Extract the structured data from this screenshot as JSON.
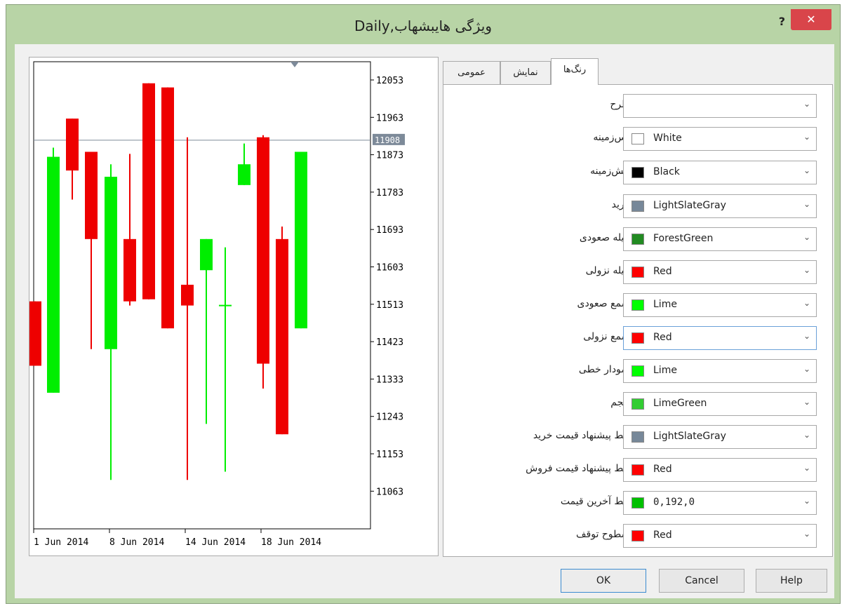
{
  "window": {
    "title": "Daily,ویژگی هایبشهاب",
    "help_label": "?",
    "close_label": "✕"
  },
  "tabs": [
    {
      "label": "رنگ‌ها",
      "active": true
    },
    {
      "label": "نمایش",
      "active": false
    },
    {
      "label": "عمومی",
      "active": false
    }
  ],
  "properties": [
    {
      "label": ":طرح",
      "value": "",
      "swatch": null
    },
    {
      "label": ":پس‌زمینه",
      "value": "White",
      "swatch": "#ffffff"
    },
    {
      "label": ":پیش‌زمینه",
      "value": "Black",
      "swatch": "#000000"
    },
    {
      "label": ":گرید",
      "value": "LightSlateGray",
      "swatch": "#778899"
    },
    {
      "label": ":میله صعودی",
      "value": "ForestGreen",
      "swatch": "#228b22"
    },
    {
      "label": ":میله نزولی",
      "value": "Red",
      "swatch": "#ff0000"
    },
    {
      "label": ":شمع صعودی",
      "value": "Lime",
      "swatch": "#00ff00"
    },
    {
      "label": ":شمع نزولی",
      "value": "Red",
      "swatch": "#ff0000"
    },
    {
      "label": ":نمودار خطی",
      "value": "Lime",
      "swatch": "#00ff00"
    },
    {
      "label": ":حجم",
      "value": "LimeGreen",
      "swatch": "#32cd32"
    },
    {
      "label": ":خط پیشنهاد قیمت خرید",
      "value": "LightSlateGray",
      "swatch": "#778899"
    },
    {
      "label": ":خط پیشنهاد قیمت فروش",
      "value": "Red",
      "swatch": "#ff0000"
    },
    {
      "label": ":خط آخرین قیمت",
      "value": "0,192,0",
      "swatch": "#00c000"
    },
    {
      "label": ":سطوح توقف",
      "value": "Red",
      "swatch": "#ff0000"
    }
  ],
  "buttons": {
    "ok": "OK",
    "cancel": "Cancel",
    "help": "Help"
  },
  "chart_data": {
    "type": "candlestick",
    "price_labels": [
      "12053",
      "11963",
      "11873",
      "11783",
      "11693",
      "11603",
      "11513",
      "11423",
      "11333",
      "11243",
      "11153",
      "11063"
    ],
    "current_price": "11908",
    "date_labels": [
      "1 Jun 2014",
      "8 Jun 2014",
      "14 Jun 2014",
      "18 Jun 2014"
    ],
    "ylim": [
      11000,
      12110
    ],
    "bull_color": "#00ee00",
    "bear_color": "#ee0000",
    "candles": [
      {
        "open": 11520,
        "close": 11365,
        "high": 11520,
        "low": 11365
      },
      {
        "open": 11300,
        "close": 11868,
        "high": 11890,
        "low": 11300
      },
      {
        "open": 11960,
        "close": 11835,
        "high": 11960,
        "low": 11765
      },
      {
        "open": 11880,
        "close": 11670,
        "high": 11880,
        "low": 11405
      },
      {
        "open": 11405,
        "close": 11820,
        "high": 11850,
        "low": 11090
      },
      {
        "open": 11670,
        "close": 11520,
        "high": 11875,
        "low": 11510
      },
      {
        "open": 12045,
        "close": 11525,
        "high": 12045,
        "low": 11525
      },
      {
        "open": 12035,
        "close": 11455,
        "high": 12035,
        "low": 11455
      },
      {
        "open": 11560,
        "close": 11510,
        "high": 11915,
        "low": 11090
      },
      {
        "open": 11595,
        "close": 11670,
        "high": 11670,
        "low": 11225
      },
      {
        "open": 11510,
        "close": 11510,
        "high": 11650,
        "low": 11110
      },
      {
        "open": 11800,
        "close": 11850,
        "high": 11900,
        "low": 11800
      },
      {
        "open": 11915,
        "close": 11370,
        "high": 11920,
        "low": 11310
      },
      {
        "open": 11670,
        "close": 11200,
        "high": 11700,
        "low": 11200
      },
      {
        "open": 11455,
        "close": 11880,
        "high": 11880,
        "low": 11455
      }
    ]
  }
}
